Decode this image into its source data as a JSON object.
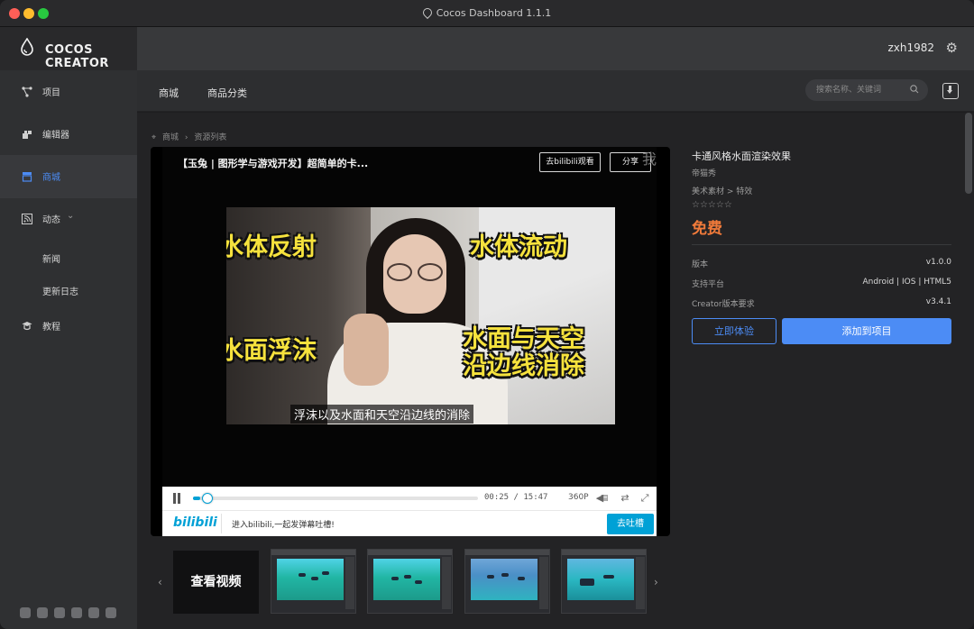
{
  "window": {
    "title": "Cocos Dashboard 1.1.1"
  },
  "brand": {
    "name": "COCOS CREATOR"
  },
  "sidebar": {
    "items": [
      {
        "label": "项目",
        "icon": "project-icon"
      },
      {
        "label": "编辑器",
        "icon": "editor-icon"
      },
      {
        "label": "商城",
        "icon": "store-icon"
      },
      {
        "label": "动态",
        "icon": "feed-icon"
      },
      {
        "label": "教程",
        "icon": "tutorial-icon"
      }
    ],
    "sub_items": [
      "新闻",
      "更新日志"
    ]
  },
  "header": {
    "username": "zxh1982"
  },
  "tabs": [
    "商城",
    "商品分类"
  ],
  "search": {
    "placeholder": "搜索名称、关键词"
  },
  "breadcrumb": [
    "商城",
    "资源列表"
  ],
  "video": {
    "title": "【玉兔 | 图形学与游戏开发】超简单的卡...",
    "watch_button": "去bilibili观看",
    "share_button": "分享",
    "corner_char": "我",
    "overlay_tl": "水体反射",
    "overlay_tr": "水体流动",
    "overlay_bl": "水面浮沫",
    "overlay_br_1": "水面与天空",
    "overlay_br_2": "沿边线消除",
    "subtitle": "浮沫以及水面和天空沿边线的消除",
    "time_current": "00:25",
    "time_total": "15:47",
    "time_sep": "/",
    "progress": 0.026,
    "quality": "360P",
    "bili_logo": "bilibili",
    "bili_text": "进入bilibili,一起发弹幕吐槽!",
    "bili_button": "去吐槽"
  },
  "gallery": {
    "watch_label": "查看视频",
    "thumb_count_shown": 4
  },
  "product": {
    "title": "卡通风格水面渲染效果",
    "author": "帝猫秀",
    "category": "美术素材 > 特效",
    "stars": "☆☆☆☆☆",
    "price": "免费",
    "specs": [
      {
        "label": "版本",
        "value": "v1.0.0"
      },
      {
        "label": "支持平台",
        "value": "Android | IOS | HTML5"
      },
      {
        "label": "Creator版本要求",
        "value": "v3.4.1"
      }
    ],
    "try_button": "立即体验",
    "add_button": "添加到项目"
  },
  "colors": {
    "accent": "#4c8cf5",
    "price": "#f07a3a",
    "bilibili": "#00a1d6",
    "overlay_text": "#f6e23d"
  }
}
